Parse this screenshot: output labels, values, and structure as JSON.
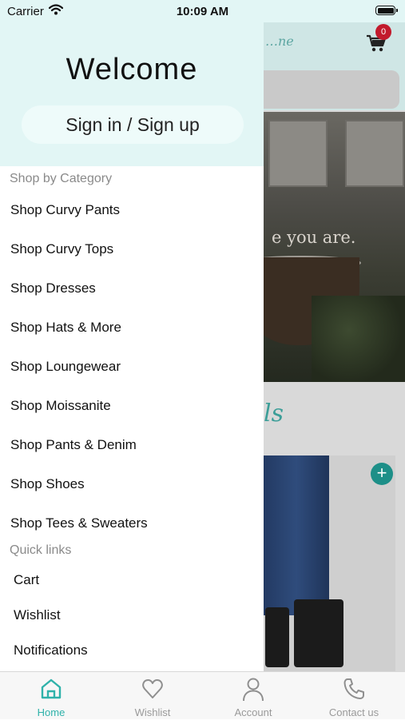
{
  "status": {
    "carrier": "Carrier",
    "time": "10:09 AM"
  },
  "background": {
    "logo": "…ne",
    "cart_count": "0",
    "hero_text": "e you are.",
    "section_text": "ls",
    "add_symbol": "+"
  },
  "drawer": {
    "welcome": "Welcome",
    "signin": "Sign in / Sign up",
    "category_heading": "Shop by Category",
    "categories": [
      "Shop Curvy Pants",
      "Shop Curvy Tops",
      "Shop Dresses",
      "Shop Hats & More",
      "Shop Loungewear",
      "Shop Moissanite",
      "Shop Pants & Denim",
      "Shop Shoes",
      "Shop Tees & Sweaters"
    ],
    "quick_heading": "Quick links",
    "quick_links": [
      "Cart",
      "Wishlist",
      "Notifications"
    ]
  },
  "tabs": [
    {
      "label": "Home",
      "icon": "home-icon",
      "active": true
    },
    {
      "label": "Wishlist",
      "icon": "heart-icon",
      "active": false
    },
    {
      "label": "Account",
      "icon": "user-icon",
      "active": false
    },
    {
      "label": "Contact us",
      "icon": "phone-icon",
      "active": false
    }
  ],
  "colors": {
    "accent": "#2fb2aa",
    "drawer_header": "#e2f6f5",
    "badge": "#c21a2c"
  }
}
